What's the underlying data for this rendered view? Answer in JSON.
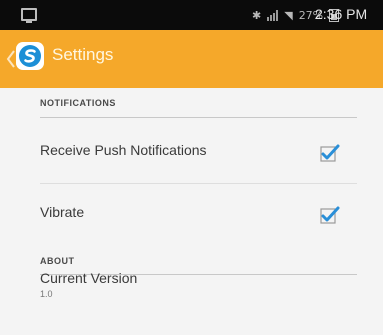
{
  "status_bar": {
    "time": "2:36 PM",
    "battery_percent": "27%",
    "icons": [
      "screen-icon",
      "bluetooth-icon",
      "signal-icon",
      "wifi-icon",
      "battery-icon"
    ]
  },
  "app_bar": {
    "title": "Settings",
    "accent_color": "#f5a82a",
    "logo_color": "#1c8fd6"
  },
  "sections": {
    "notifications": {
      "header": "NOTIFICATIONS",
      "rows": [
        {
          "label": "Receive Push Notifications",
          "checked": true
        },
        {
          "label": "Vibrate",
          "checked": true
        }
      ]
    },
    "about": {
      "header": "ABOUT",
      "version_label": "Current Version",
      "version_value": "1.0"
    }
  },
  "checkbox_color": "#2a8fd8"
}
